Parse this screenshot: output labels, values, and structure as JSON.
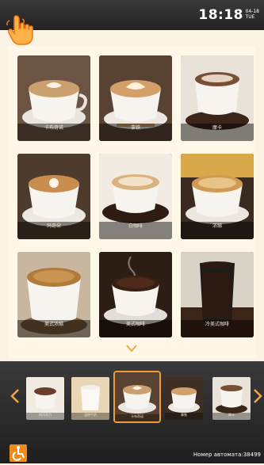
{
  "status_bar": {
    "time": "18:18",
    "date_num": "04-18",
    "weekday": "TUE"
  },
  "menu": {
    "items": [
      {
        "label": "卡布奇诺",
        "cup": "#f7f4ef",
        "foam": "#caa16e",
        "art": "#fff3e2"
      },
      {
        "label": "拿铁",
        "cup": "#f7f4ef",
        "foam": "#d3a06a",
        "art": "#fff0db"
      },
      {
        "label": "摩卡",
        "cup": "#f7f4ef",
        "foam": "#7a4e34",
        "art": "#e6d4c3"
      },
      {
        "label": "玛奇朵",
        "cup": "#f7f4ef",
        "foam": "#c88d4f",
        "art": "#fff4e6"
      },
      {
        "label": "白咖啡",
        "cup": "#f7f4ef",
        "foam": "#d9b37f",
        "art": "#f2e2c8"
      },
      {
        "label": "浓缩",
        "cup": "#f7f4ef",
        "foam": "#d09a52",
        "art": "#e8c488"
      },
      {
        "label": "美式浓缩",
        "cup": "#f7f4ef",
        "foam": "#b07a3d",
        "art": "#c9944f"
      },
      {
        "label": "美式咖啡",
        "cup": "#f7f4ef",
        "foam": "#3a2014",
        "art": "#4d2a19"
      },
      {
        "label": "冷美式咖啡",
        "cup": "#1f1b18",
        "foam": "#2a1a12",
        "art": "#2a1a12"
      }
    ]
  },
  "tray": {
    "items": [
      {
        "label": "热巧克力",
        "foam": "#6a3e2a"
      },
      {
        "label": "温热牛奶",
        "foam": "#f3efe8"
      },
      {
        "label": "卡布奇诺",
        "foam": "#caa16e",
        "selected": true
      },
      {
        "label": "拿铁",
        "foam": "#d3a06a"
      },
      {
        "label": "摩卡",
        "foam": "#7a4e34"
      }
    ]
  },
  "footer": {
    "machine_label": "Номер автомата:38499"
  },
  "colors": {
    "accent": "#f08b1a",
    "selected_outline": "#f09a3a"
  },
  "icons": {
    "pointer": "hand-pointer-icon",
    "scroll": "chevron-down-icon",
    "prev": "chevron-left-icon",
    "next": "chevron-right-icon",
    "accessibility": "wheelchair-icon"
  }
}
